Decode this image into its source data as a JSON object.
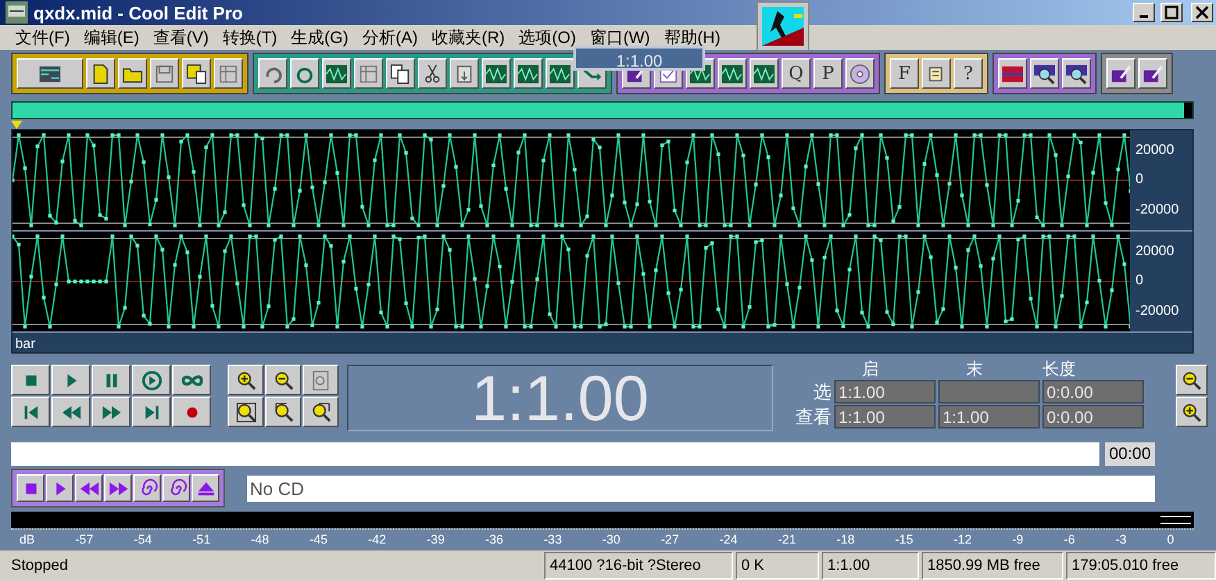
{
  "window": {
    "title": "qxdx.mid - Cool Edit Pro"
  },
  "menu": [
    "文件(F)",
    "编辑(E)",
    "查看(V)",
    "转换(T)",
    "生成(G)",
    "分析(A)",
    "收藏夹(R)",
    "选项(O)",
    "窗口(W)",
    "帮助(H)"
  ],
  "popup": {
    "text": "1:1.00"
  },
  "toolbar": [
    {
      "color": "#c8a400",
      "buttons": [
        {
          "kind": "tracks"
        },
        {
          "kind": "doc"
        },
        {
          "kind": "folder"
        },
        {
          "kind": "disk"
        },
        {
          "kind": "saveas"
        },
        {
          "kind": "grid"
        }
      ]
    },
    {
      "color": "#2a9a86",
      "buttons": [
        {
          "kind": "undo"
        },
        {
          "kind": "redo"
        },
        {
          "kind": "wave"
        },
        {
          "kind": "grid"
        },
        {
          "kind": "copy"
        },
        {
          "kind": "scissors"
        },
        {
          "kind": "paste"
        },
        {
          "kind": "wave"
        },
        {
          "kind": "wave"
        },
        {
          "kind": "wave"
        },
        {
          "kind": "arrow"
        }
      ]
    },
    {
      "color": "#9c6ad2",
      "buttons": [
        {
          "kind": "pencil"
        },
        {
          "kind": "check"
        },
        {
          "kind": "wave"
        },
        {
          "kind": "wave"
        },
        {
          "kind": "wave"
        },
        {
          "kind": "letter",
          "label": "Q"
        },
        {
          "kind": "letter",
          "label": "P"
        },
        {
          "kind": "cd"
        }
      ]
    },
    {
      "color": "#dcc080",
      "buttons": [
        {
          "kind": "letter",
          "label": "F"
        },
        {
          "kind": "scroll"
        },
        {
          "kind": "letter",
          "label": "?"
        }
      ]
    },
    {
      "color": "#9c6ad2",
      "buttons": [
        {
          "kind": "bars"
        },
        {
          "kind": "zoomwave"
        },
        {
          "kind": "zoomwave"
        }
      ]
    },
    {
      "color": "#8c8c8c",
      "buttons": [
        {
          "kind": "pencil"
        },
        {
          "kind": "pencil"
        }
      ]
    }
  ],
  "channels": [
    {
      "ticks": [
        "20000",
        "0",
        "-20000"
      ]
    },
    {
      "ticks": [
        "20000",
        "0",
        "-20000"
      ]
    }
  ],
  "ruler_label": "bar",
  "transport": [
    {
      "kind": "stop"
    },
    {
      "kind": "play"
    },
    {
      "kind": "pause"
    },
    {
      "kind": "playcircle"
    },
    {
      "kind": "loop"
    },
    {
      "kind": "begin"
    },
    {
      "kind": "rewind"
    },
    {
      "kind": "ffwd"
    },
    {
      "kind": "end"
    },
    {
      "kind": "record"
    }
  ],
  "zoom": [
    {
      "kind": "zoomin"
    },
    {
      "kind": "zoomout"
    },
    {
      "kind": "zoomfull"
    },
    {
      "kind": "zoomsel"
    },
    {
      "kind": "zoomleft"
    },
    {
      "kind": "zoomright"
    }
  ],
  "time": "1:1.00",
  "selection": {
    "headers": [
      "启",
      "末",
      "长度"
    ],
    "rows": [
      {
        "label": "选",
        "start": "1:1.00",
        "length": "0:0.00"
      },
      {
        "label": "查看",
        "start": "1:1.00",
        "end": "1:1.00",
        "length": "0:0.00"
      }
    ]
  },
  "side_zoom": [
    {
      "kind": "zoomout"
    },
    {
      "kind": "zoomin"
    }
  ],
  "progress": {
    "level": 0,
    "time": "00:00"
  },
  "cd": {
    "buttons": [
      {
        "kind": "stop"
      },
      {
        "kind": "play"
      },
      {
        "kind": "rewind"
      },
      {
        "kind": "ffwd"
      },
      {
        "kind": "spiral"
      },
      {
        "kind": "spiral"
      },
      {
        "kind": "eject"
      }
    ],
    "status": "No CD"
  },
  "meter_scale": [
    "dB",
    "-57",
    "-54",
    "-51",
    "-48",
    "-45",
    "-42",
    "-39",
    "-36",
    "-33",
    "-30",
    "-27",
    "-24",
    "-21",
    "-18",
    "-15",
    "-12",
    "-9",
    "-6",
    "-3",
    "0"
  ],
  "status_bar": [
    "Stopped",
    "44100 ?16-bit ?Stereo",
    "0 K",
    "1:1.00",
    "1850.99 MB free",
    "179:05.010 free"
  ]
}
